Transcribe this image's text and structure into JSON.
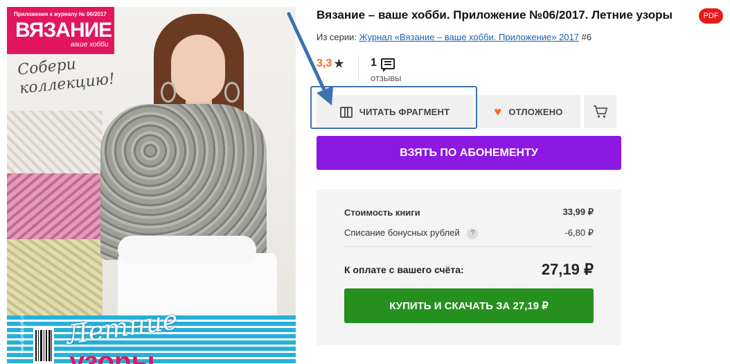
{
  "cover": {
    "supertitle": "Приложение к журналу № 06/2017",
    "magazine_name": "ВЯЗАНИЕ",
    "magazine_sub": "ваше хобби",
    "slogan": "Собери\nколлекцию!",
    "title_line1": "Летние",
    "title_line2": "узоры",
    "site_label": "www.burdastyle.ru"
  },
  "book": {
    "title": "Вязание – ваше хобби. Приложение №06/2017. Летние узоры",
    "format_badge": "PDF",
    "series_prefix": "Из серии:",
    "series_link": "Журнал «Вязание – ваше хобби. Приложение» 2017",
    "series_number": "#6"
  },
  "rating": {
    "value": "3,3",
    "star": "★",
    "reviews_count": "1",
    "reviews_label": "отзывы"
  },
  "actions": {
    "read_fragment": "ЧИТАТЬ ФРАГМЕНТ",
    "deferred": "ОТЛОЖЕНО",
    "cart_icon": "🛒",
    "subscribe": "ВЗЯТЬ ПО АБОНЕМЕНТУ"
  },
  "pricing": {
    "book_cost_label": "Стоимость книги",
    "book_cost_value": "33,99 ₽",
    "bonus_label": "Списание бонусных рублей",
    "bonus_help": "?",
    "bonus_value": "-6,80 ₽",
    "total_label": "К оплате с вашего счёта:",
    "total_value": "27,19 ₽",
    "buy_button": "КУПИТЬ И СКАЧАТЬ ЗА 27,19 ₽"
  },
  "colors": {
    "subscribe_purple": "#8c18e2",
    "buy_green": "#26901f",
    "rating_orange": "#ff6a1a",
    "pdf_red": "#e81a1a",
    "highlight_blue": "#3a73b0"
  }
}
